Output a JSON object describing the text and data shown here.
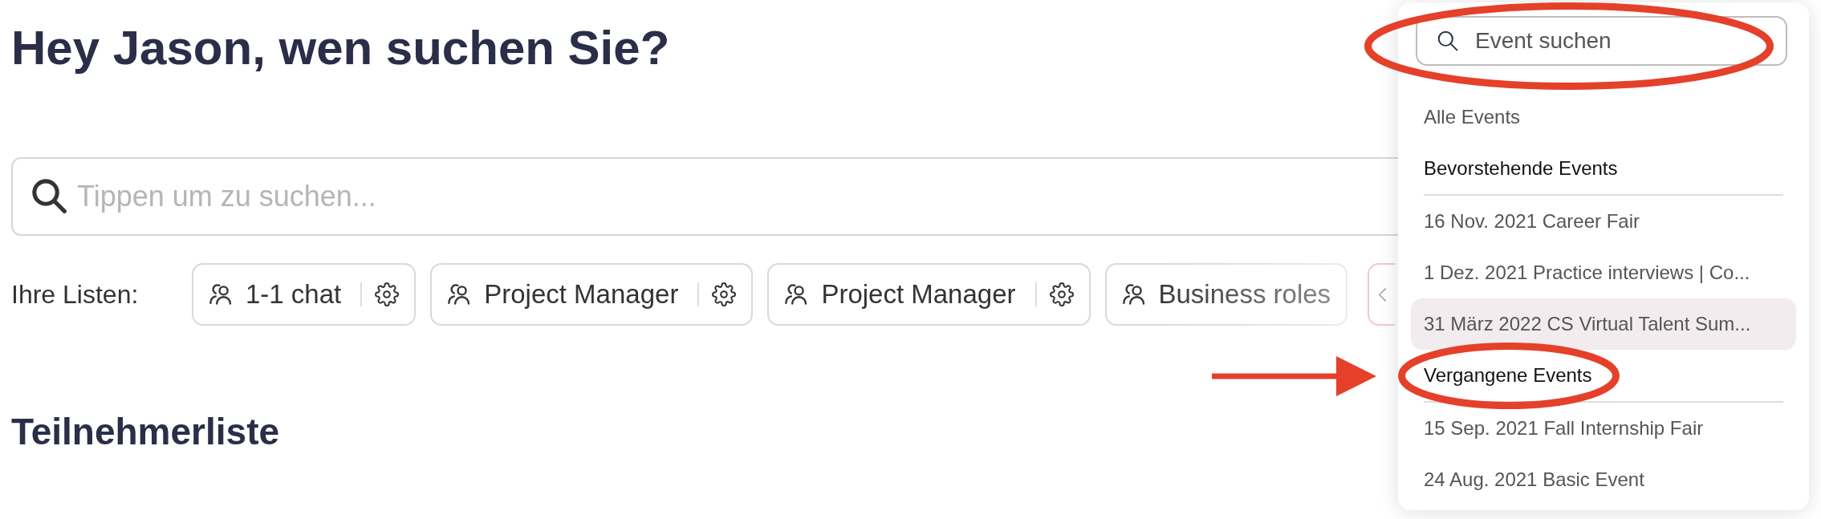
{
  "title": "Hey Jason, wen suchen Sie?",
  "search": {
    "placeholder": "Tippen um zu suchen..."
  },
  "lists": {
    "label": "Ihre Listen:",
    "chips": [
      {
        "name": "1-1 chat",
        "settings_icon": true
      },
      {
        "name": "Project Manager",
        "settings_icon": true
      },
      {
        "name": "Project Manager",
        "settings_icon": true
      },
      {
        "name": "Business roles",
        "settings_icon": false
      }
    ]
  },
  "participants_heading": "Teilnehmerliste",
  "event_menu": {
    "search": {
      "placeholder": "Event suchen",
      "circled": true
    },
    "all_events": {
      "label": "Alle Events",
      "selected": false
    },
    "sections": [
      {
        "title": "Bevorstehende Events",
        "circled": false,
        "arrow": false,
        "events": [
          {
            "label": "16 Nov. 2021 Career Fair",
            "selected": false
          },
          {
            "label": "1 Dez. 2021 Practice interviews | Co...",
            "selected": false
          },
          {
            "label": "31 März 2022 CS Virtual Talent Sum...",
            "selected": true
          }
        ]
      },
      {
        "title": "Vergangene Events",
        "circled": true,
        "arrow": true,
        "events": [
          {
            "label": "15 Sep. 2021 Fall Internship Fair",
            "selected": false
          },
          {
            "label": "24 Aug. 2021 Basic Event",
            "selected": false
          }
        ]
      }
    ]
  }
}
